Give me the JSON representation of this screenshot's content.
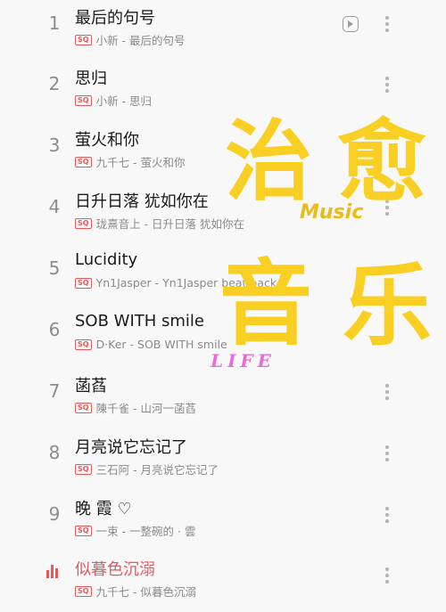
{
  "tracks": [
    {
      "rank": "1",
      "title": "最后的句号",
      "badge": "SQ",
      "sub": "小新 - 最后的句号"
    },
    {
      "rank": "2",
      "title": "思归",
      "badge": "SQ",
      "sub": "小新 - 思归"
    },
    {
      "rank": "3",
      "title": "萤火和你",
      "badge": "SQ",
      "sub": "九千七 - 萤火和你"
    },
    {
      "rank": "4",
      "title": "日升日落 犹如你在",
      "badge": "SQ",
      "sub": "珑熹音上 - 日升日落 犹如你在"
    },
    {
      "rank": "5",
      "title": "Lucidity",
      "badge": "SQ",
      "sub": "Yn1Jasper - Yn1Jasper beat pack"
    },
    {
      "rank": "6",
      "title": "SOB WITH smile",
      "badge": "SQ",
      "sub": "D·Ker - SOB WITH smile"
    },
    {
      "rank": "7",
      "title": "菡萏",
      "badge": "SQ",
      "sub": "陳千雀 - 山河一菡萏"
    },
    {
      "rank": "8",
      "title": "月亮说它忘记了",
      "badge": "SQ",
      "sub": "三石阿 - 月亮说它忘记了"
    },
    {
      "rank": "9",
      "title": "晚 霞 ♡",
      "badge": "SQ",
      "sub": "一束 - 一整碗的 · 雲"
    },
    {
      "rank": "",
      "title": "似暮色沉溺",
      "badge": "SQ",
      "sub": "九千七 - 似暮色沉溺"
    }
  ],
  "overlay": {
    "heading_top_left": "治",
    "heading_top_right": "愈",
    "heading_bottom_left": "音",
    "heading_bottom_right": "乐",
    "music": "Music",
    "life": "LIFE"
  },
  "colors": {
    "accent": "#e05a5a",
    "overlay_yellow": "#f8cf22",
    "life_pink": "#ec6ad8"
  },
  "icons": [
    "play-mv-icon",
    "more-dots-icon",
    "now-playing-bars-icon"
  ]
}
